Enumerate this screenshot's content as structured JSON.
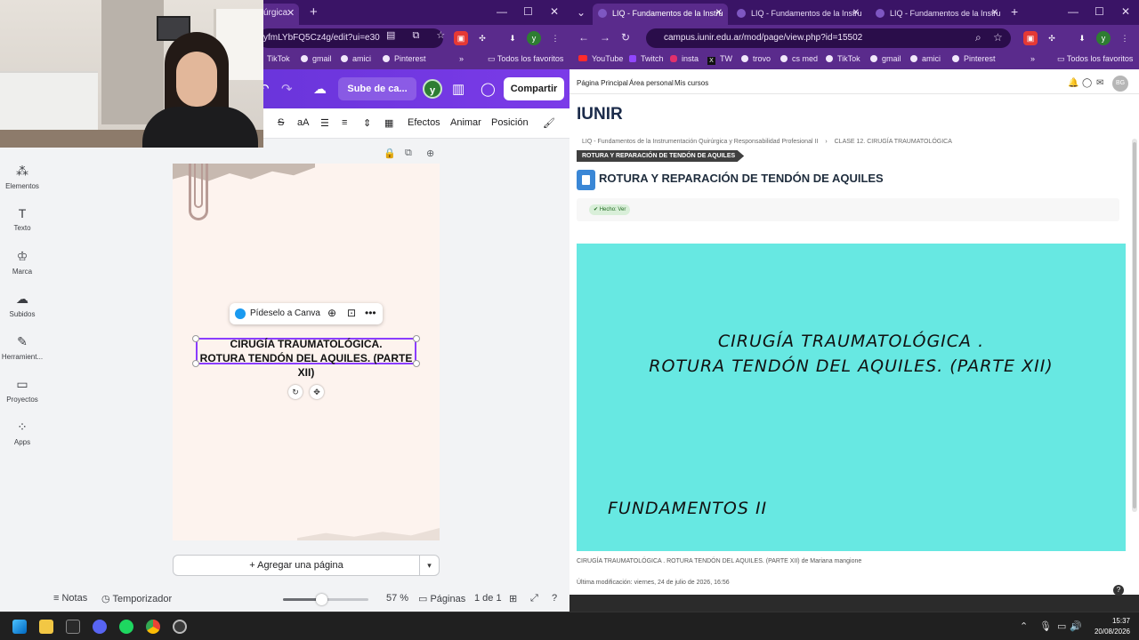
{
  "left_browser": {
    "tab_title": "úrgica",
    "url": "yfmLYbFQ5Cz4g/edit?ui=e30",
    "bookmarks": [
      "TikTok",
      "gmail",
      "amici",
      "Pinterest"
    ],
    "all_bookmarks": "Todos los favoritos"
  },
  "canva": {
    "top": {
      "upload_label": "Sube de ca...",
      "user_initial": "y",
      "share_label": "Compartir"
    },
    "tools": {
      "strike": "S",
      "text_size": "aA",
      "effects": "Efectos",
      "animate": "Animar",
      "position": "Posición"
    },
    "sidebar": [
      {
        "label": "Elementos",
        "icon": "elements-icon"
      },
      {
        "label": "Texto",
        "icon": "text-icon"
      },
      {
        "label": "Marca",
        "icon": "brand-icon"
      },
      {
        "label": "Subidos",
        "icon": "uploads-icon"
      },
      {
        "label": "Herramient...",
        "icon": "tools-icon"
      },
      {
        "label": "Proyectos",
        "icon": "projects-icon"
      },
      {
        "label": "Apps",
        "icon": "apps-icon"
      }
    ],
    "popup_label": "Pídeselo a Canva",
    "design_text_line1": "CIRUGÍA TRAUMATOLÓGICA.",
    "design_text_line2": "ROTURA TENDÓN DEL AQUILES. (PARTE XII)",
    "add_page_label": "+ Agregar una página",
    "bottom": {
      "notes": "Notas",
      "timer": "Temporizador",
      "zoom_fraction": 0.45,
      "zoom_value": "57 %",
      "pages_label": "Páginas",
      "page_count": "1 de 1"
    }
  },
  "right_browser": {
    "tabs": [
      {
        "title": "LIQ - Fundamentos de la Instru",
        "active": true
      },
      {
        "title": "LIQ - Fundamentos de la Instru",
        "active": false
      },
      {
        "title": "LIQ - Fundamentos de la Instru",
        "active": false
      }
    ],
    "url": "campus.iunir.edu.ar/mod/page/view.php?id=15502",
    "bookmarks": [
      "YouTube",
      "Twitch",
      "insta",
      "TW",
      "trovo",
      "cs med",
      "TikTok",
      "gmail",
      "amici",
      "Pinterest"
    ],
    "all_bookmarks": "Todos los favoritos"
  },
  "moodle": {
    "nav": [
      "Página Principal",
      "Área personal",
      "Mis cursos"
    ],
    "avatar_initials": "BG",
    "logo_text": "IUNIR",
    "breadcrumb_course": "LIQ - Fundamentos de la Instrumentación Quirúrgica y Responsabilidad Profesional II",
    "breadcrumb_section": "CLASE 12. CIRUGÍA TRAUMATOLÓGICA",
    "breadcrumb_current": "ROTURA Y REPARACIÓN DE TENDÓN DE AQUILES",
    "page_title": "ROTURA Y REPARACIÓN DE TENDÓN DE AQUILES",
    "done_badge": "✔ Hecho: Ver",
    "embed_line1": "CIRUGÍA TRAUMATOLÓGICA .",
    "embed_line2": "ROTURA TENDÓN DEL AQUILES. (PARTE XII)",
    "embed_line3": "FUNDAMENTOS II",
    "embed_color": "#67e8e2",
    "caption": "CIRUGÍA TRAUMATOLÓGICA . ROTURA TENDÓN DEL AQUILES. (PARTE XII) de Mariana mangione",
    "last_modified": "Última modificación: viernes, 24 de julio de 2026, 16:56"
  },
  "taskbar": {
    "time": "15:37",
    "date": "20/08/2026"
  }
}
